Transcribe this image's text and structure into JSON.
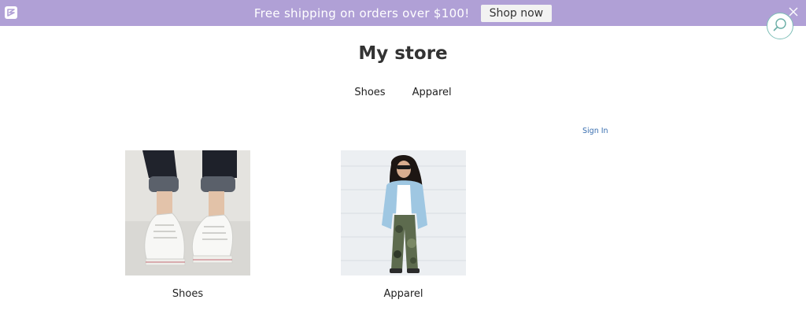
{
  "promo": {
    "message": "Free shipping on orders over $100!",
    "button_label": "Shop now",
    "background_color": "#b0a0d6"
  },
  "store": {
    "title": "My store"
  },
  "nav": {
    "items": [
      {
        "label": "Shoes"
      },
      {
        "label": "Apparel"
      }
    ]
  },
  "account": {
    "signin_label": "Sign In",
    "link_color": "#3a6fb0"
  },
  "categories": [
    {
      "label": "Shoes",
      "image_icon": "sneakers-photo"
    },
    {
      "label": "Apparel",
      "image_icon": "fashion-model-photo"
    }
  ],
  "icons": {
    "logo": "store-logo-icon",
    "close": "close-icon",
    "search": "search-icon"
  }
}
